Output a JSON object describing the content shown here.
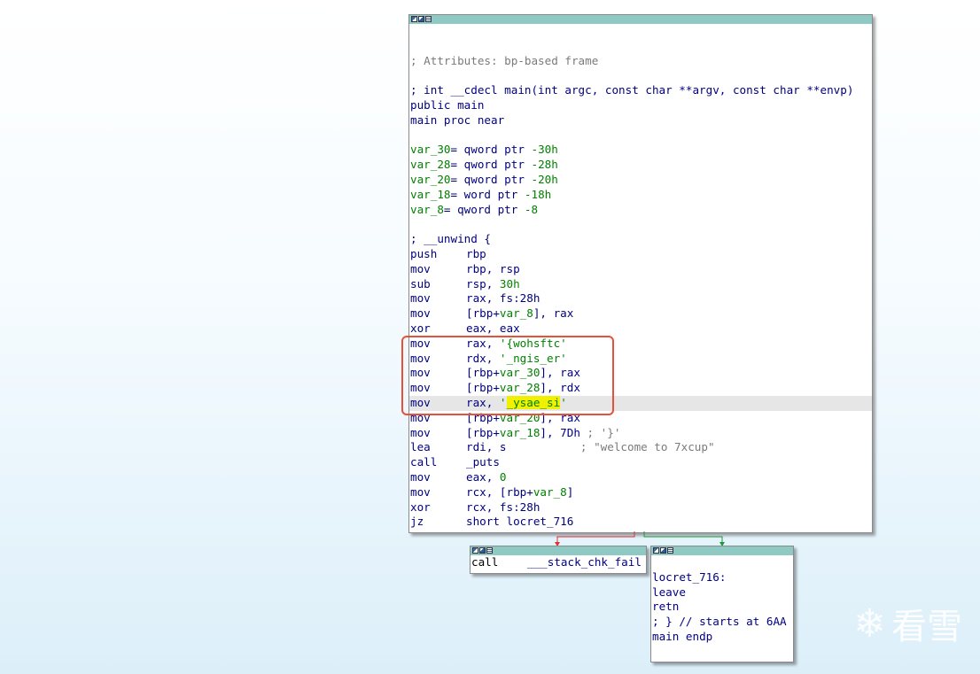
{
  "main_block": {
    "lines": [
      {
        "type": "blank"
      },
      {
        "type": "blank"
      },
      {
        "type": "comment",
        "text": "; Attributes: bp-based frame"
      },
      {
        "type": "blank"
      },
      {
        "type": "plain",
        "text": "; int __cdecl main(int argc, const char **argv, const char **envp)"
      },
      {
        "type": "plain",
        "text": "public main"
      },
      {
        "type": "plain",
        "text": "main proc near"
      },
      {
        "type": "blank"
      },
      {
        "type": "vardecl",
        "var": "var_30",
        "rest": "= qword ptr ",
        "num": "-30h"
      },
      {
        "type": "vardecl",
        "var": "var_28",
        "rest": "= qword ptr ",
        "num": "-28h"
      },
      {
        "type": "vardecl",
        "var": "var_20",
        "rest": "= qword ptr ",
        "num": "-20h"
      },
      {
        "type": "vardecl",
        "var": "var_18",
        "rest": "= word ptr ",
        "num": "-18h"
      },
      {
        "type": "vardecl",
        "var": "var_8",
        "rest": "= qword ptr ",
        "num": "-8"
      },
      {
        "type": "blank"
      },
      {
        "type": "plain",
        "text": "; __unwind {"
      },
      {
        "type": "instr",
        "mnem": "push",
        "op": "rbp"
      },
      {
        "type": "instr",
        "mnem": "mov",
        "op": "rbp, rsp"
      },
      {
        "type": "instr",
        "mnem": "sub",
        "op": "rsp, ",
        "num": "30h"
      },
      {
        "type": "instr",
        "mnem": "mov",
        "op": "rax, fs:28h"
      },
      {
        "type": "instr",
        "mnem": "mov",
        "op": "[rbp+",
        "var": "var_8",
        "op2": "], rax"
      },
      {
        "type": "instr",
        "mnem": "xor",
        "op": "eax, eax"
      },
      {
        "type": "instr",
        "mnem": "mov",
        "op": "rax, ",
        "str": "'{wohsftc'"
      },
      {
        "type": "instr",
        "mnem": "mov",
        "op": "rdx, ",
        "str": "'_ngis_er'"
      },
      {
        "type": "instr",
        "mnem": "mov",
        "op": "[rbp+",
        "var": "var_30",
        "op2": "], rax"
      },
      {
        "type": "instr",
        "mnem": "mov",
        "op": "[rbp+",
        "var": "var_28",
        "op2": "], rdx"
      },
      {
        "type": "instr",
        "mnem": "mov",
        "op": "rax, ",
        "str_pre": "'",
        "str_hl": "_ysae_si",
        "str_post": "'",
        "highlight": true
      },
      {
        "type": "instr",
        "mnem": "mov",
        "op": "[rbp+",
        "var": "var_20",
        "op2": "], rax"
      },
      {
        "type": "instr",
        "mnem": "mov",
        "op": "[rbp+",
        "var": "var_18",
        "op2": "], 7Dh ",
        "comment": "; '}'"
      },
      {
        "type": "instr",
        "mnem": "lea",
        "op": "rdi, s           ",
        "comment": "; \"welcome to 7xcup\""
      },
      {
        "type": "instr",
        "mnem": "call",
        "op": "_puts"
      },
      {
        "type": "instr",
        "mnem": "mov",
        "op": "eax, ",
        "num": "0"
      },
      {
        "type": "instr",
        "mnem": "mov",
        "op": "rcx, [rbp+",
        "var": "var_8",
        "op2": "]"
      },
      {
        "type": "instr",
        "mnem": "xor",
        "op": "rcx, fs:28h"
      },
      {
        "type": "instr",
        "mnem": "jz",
        "op": "short locret_716"
      }
    ]
  },
  "fail_block": {
    "mnem": "call",
    "op": "___stack_chk_fail"
  },
  "ret_block": {
    "lines": [
      "",
      "locret_716:",
      "leave",
      "retn",
      "; } // starts at 6AA",
      "main endp"
    ]
  },
  "watermark": {
    "text": "看雪"
  },
  "colors": {
    "titlebar": "#8fc9c4",
    "code_navy": "#000080",
    "code_green": "#008000",
    "highlight_box": "#e8503a",
    "edge_red": "#e03030",
    "edge_green": "#1a9a3a"
  },
  "icons": [
    "graph-node-icon",
    "graph-edit-icon",
    "graph-list-icon",
    "snowflake-logo-icon"
  ]
}
